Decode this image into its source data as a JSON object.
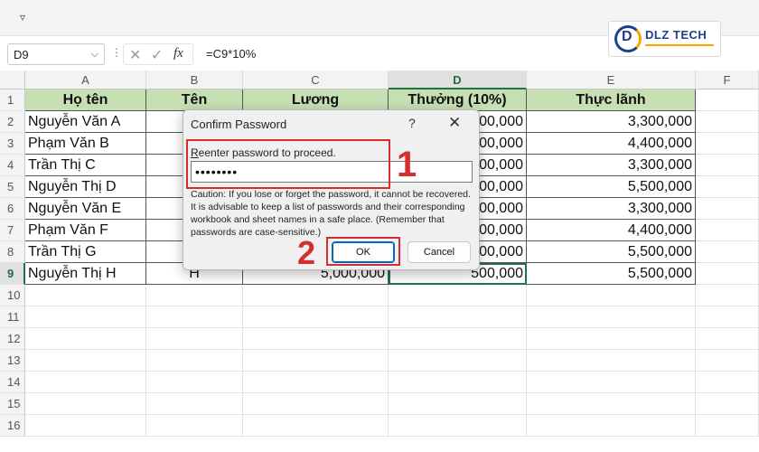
{
  "quick_access": {
    "customize_icon": "customize-toolbar-icon"
  },
  "logo": {
    "text": "DLZ TECH"
  },
  "formula_bar": {
    "name_box": "D9",
    "formula": "=C9*10%",
    "fx_label": "fx"
  },
  "columns": [
    "A",
    "B",
    "C",
    "D",
    "E",
    "F"
  ],
  "rows": [
    "1",
    "2",
    "3",
    "4",
    "5",
    "6",
    "7",
    "8",
    "9",
    "10",
    "11",
    "12",
    "13",
    "14",
    "15",
    "16"
  ],
  "table": {
    "headers": [
      "Họ tên",
      "Tên",
      "Lương",
      "Thưởng (10%)",
      "Thực lãnh"
    ],
    "rows": [
      [
        "Nguyễn Văn A",
        "",
        "",
        "00,000",
        "3,300,000"
      ],
      [
        "Phạm Văn B",
        "",
        "",
        "00,000",
        "4,400,000"
      ],
      [
        "Trần Thị C",
        "",
        "",
        "00,000",
        "3,300,000"
      ],
      [
        "Nguyễn Thị D",
        "",
        "",
        "00,000",
        "5,500,000"
      ],
      [
        "Nguyễn Văn E",
        "",
        "",
        "00,000",
        "3,300,000"
      ],
      [
        "Phạm Văn F",
        "",
        "",
        "00,000",
        "4,400,000"
      ],
      [
        "Trần Thị G",
        "",
        "",
        "00,000",
        "5,500,000"
      ],
      [
        "Nguyễn Thị H",
        "H",
        "5,000,000",
        "500,000",
        "5,500,000"
      ]
    ]
  },
  "dialog": {
    "title": "Confirm Password",
    "help": "?",
    "close_icon": "close-icon",
    "label_prefix": "R",
    "label_rest": "eenter password to proceed.",
    "password_value": "••••••••",
    "caution": "Caution: If you lose or forget the password, it cannot be recovered. It is advisable to keep a list of passwords and their corresponding workbook and sheet names in a safe place. (Remember that passwords are case-sensitive.)",
    "ok_label": "OK",
    "cancel_label": "Cancel"
  },
  "annotations": {
    "step1": "1",
    "step2": "2",
    "color": "#d32f2f"
  }
}
